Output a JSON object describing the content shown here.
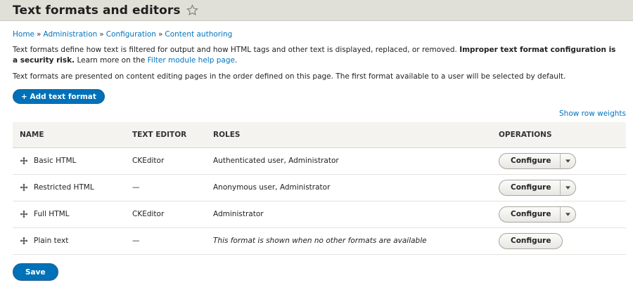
{
  "page": {
    "title": "Text formats and editors"
  },
  "breadcrumb": [
    "Home",
    "Administration",
    "Configuration",
    "Content authoring"
  ],
  "description": {
    "text1": "Text formats define how text is filtered for output and how HTML tags and other text is displayed, replaced, or removed. ",
    "bold": "Improper text format configuration is a security risk.",
    "text2": " Learn more on the ",
    "link": "Filter module help page",
    "text3": ".",
    "line2": "Text formats are presented on content editing pages in the order defined on this page. The first format available to a user will be selected by default."
  },
  "actions": {
    "add": "+ Add text format",
    "row_weights": "Show row weights",
    "save": "Save"
  },
  "table": {
    "headers": [
      "Name",
      "Text editor",
      "Roles",
      "Operations"
    ],
    "rows": [
      {
        "name": "Basic HTML",
        "editor": "CKEditor",
        "roles": "Authenticated user, Administrator",
        "op": "Configure"
      },
      {
        "name": "Restricted HTML",
        "editor": "—",
        "roles": "Anonymous user, Administrator",
        "op": "Configure"
      },
      {
        "name": "Full HTML",
        "editor": "CKEditor",
        "roles": "Administrator",
        "op": "Configure"
      },
      {
        "name": "Plain text",
        "editor": "—",
        "roles": "This format is shown when no other formats are available",
        "op": "Configure"
      }
    ]
  },
  "icons": {
    "favorite": "star-outline-icon",
    "drag": "drag-handle-icon",
    "dropdown": "caret-down-icon"
  },
  "colors": {
    "link": "#0074bd",
    "primary_button": "#0071b8",
    "header_bg": "#e0e0d8",
    "table_head_bg": "#f4f3ef"
  }
}
